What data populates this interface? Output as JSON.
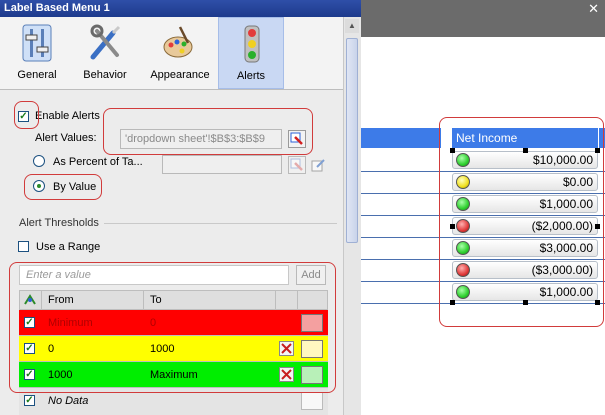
{
  "window": {
    "title": "Label Based Menu 1",
    "close_glyph": "✕"
  },
  "tabs": [
    {
      "label": "General",
      "icon": "general-sliders-icon",
      "active": false
    },
    {
      "label": "Behavior",
      "icon": "behavior-tools-icon",
      "active": false
    },
    {
      "label": "Appearance",
      "icon": "appearance-palette-icon",
      "active": false
    },
    {
      "label": "Alerts",
      "icon": "alerts-traffic-light-icon",
      "active": true
    }
  ],
  "alerts": {
    "enable_label": "Enable Alerts",
    "enabled_mark": "✓",
    "alert_values_label": "Alert Values:",
    "alert_values_value": "'dropdown sheet'!$B$3:$B$9",
    "as_percent_label": "As Percent of Ta...",
    "by_value_label": "By Value",
    "thresholds_heading": "Alert Thresholds",
    "use_range_label": "Use a Range",
    "enter_value_placeholder": "Enter a value",
    "add_label": "Add"
  },
  "thresholds": {
    "columns": {
      "from": "From",
      "to": "To"
    },
    "rows": [
      {
        "from": "Minimum",
        "to": "0",
        "color": "#ff0000",
        "swatch": "#f4a0a0",
        "checked": "✓",
        "deletable": false
      },
      {
        "from": "0",
        "to": "1000",
        "color": "#ffff00",
        "swatch": "#fff8c0",
        "checked": "✓",
        "deletable": true
      },
      {
        "from": "1000",
        "to": "Maximum",
        "color": "#00ee00",
        "swatch": "#b8f0b8",
        "checked": "✓",
        "deletable": true
      }
    ],
    "no_data": {
      "label": "No Data",
      "checked": "✓"
    }
  },
  "net_income": {
    "header": "Net Income",
    "rows": [
      {
        "value": "$10,000.00",
        "status": "green"
      },
      {
        "value": "$0.00",
        "status": "yellow"
      },
      {
        "value": "$1,000.00",
        "status": "green"
      },
      {
        "value": "($2,000.00)",
        "status": "red"
      },
      {
        "value": "$3,000.00",
        "status": "green"
      },
      {
        "value": "($3,000.00)",
        "status": "red"
      },
      {
        "value": "$1,000.00",
        "status": "green"
      }
    ]
  },
  "colors": {
    "accent": "#3d7be8",
    "highlight_border": "#d13b3b",
    "status_green": "#2fd02f",
    "status_yellow": "#f0e020",
    "status_red": "#e03a3a"
  }
}
